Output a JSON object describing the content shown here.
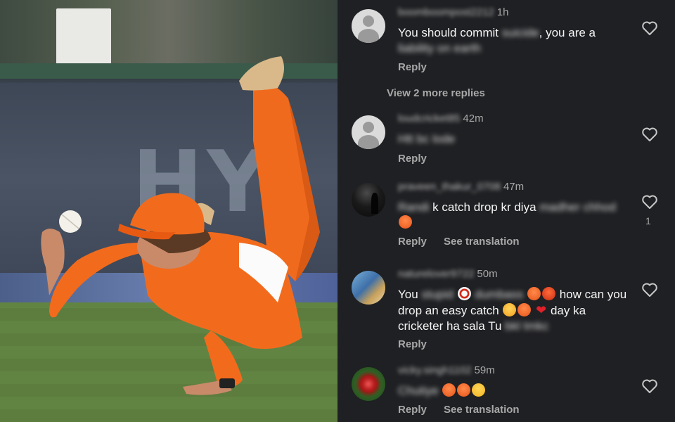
{
  "photo": {
    "board_text": "HYI"
  },
  "comments": [
    {
      "username": "boomboompost2212",
      "time": "1h",
      "text": [
        "You should commit ",
        "suicide",
        ", you are a ",
        "liability on earth",
        ""
      ],
      "reply_label": "Reply",
      "liked_count": ""
    },
    {
      "username": "loudcricket85",
      "time": "42m",
      "text": [
        "",
        "Htt bc lode",
        "",
        "",
        ""
      ],
      "reply_label": "Reply",
      "liked_count": ""
    },
    {
      "username": "praveen_thakur_0708",
      "time": "47m",
      "text": [
        "",
        "Randi",
        " k catch drop kr diya ",
        "madher chhod",
        ""
      ],
      "reply_label": "Reply",
      "translation_label": "See translation",
      "liked_count": "1"
    },
    {
      "username": "naturelover9722",
      "time": "50m",
      "text": [
        "You ",
        "stupid",
        " ",
        "dumbass",
        " how can you drop an easy catch",
        " day ka cricketer ha sala Tu",
        "bkl tmkc"
      ],
      "reply_label": "Reply",
      "liked_count": ""
    },
    {
      "username": "vicky.singh1102",
      "time": "59m",
      "text": [
        "",
        "Chutiye",
        "",
        "",
        ""
      ],
      "reply_label": "Reply",
      "translation_label": "See translation",
      "liked_count": ""
    }
  ],
  "view_more_replies": "View 2 more replies",
  "icons": {
    "like": "heart-outline-icon",
    "emoji_angry": "angry-face-icon",
    "emoji_curse": "cursing-face-icon",
    "emoji_steam": "steam-nose-face-icon",
    "emoji_smile": "grinning-face-icon",
    "emoji_heart": "red-heart-icon",
    "emoji_prohibited": "prohibited-icon"
  },
  "colors": {
    "background": "#1f2023",
    "text": "#f5f5f5",
    "secondary": "#a8a8a8"
  }
}
